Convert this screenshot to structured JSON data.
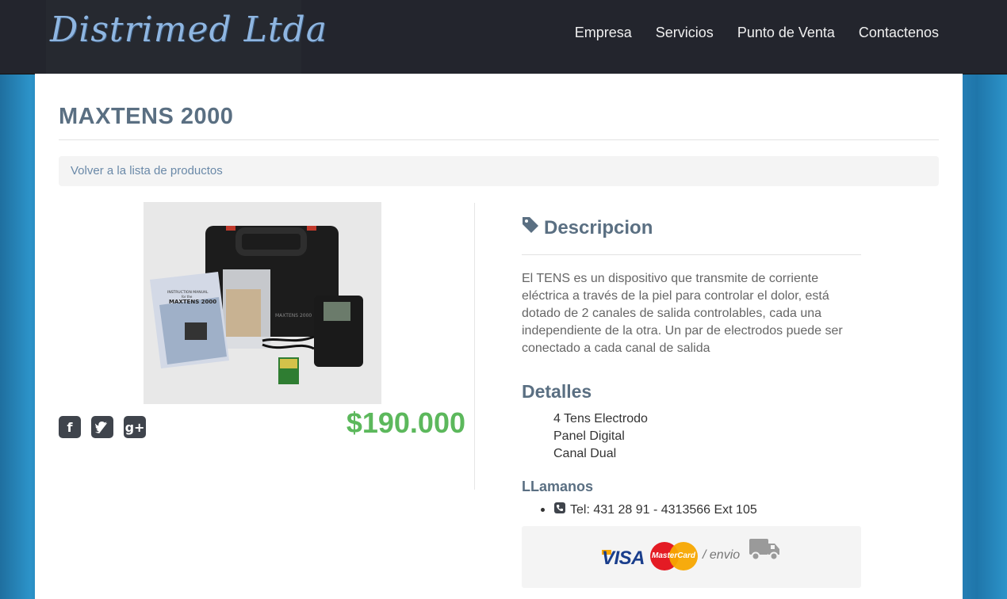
{
  "header": {
    "logo": "Distrimed Ltda",
    "nav": [
      "Empresa",
      "Servicios",
      "Punto de Venta",
      "Contactenos"
    ]
  },
  "product": {
    "title": "MAXTENS 2000",
    "back_link": "Volver a la lista de productos",
    "price": "$190.000",
    "image_labels": {
      "manual_line1": "INSTRUCTION MANUAL",
      "manual_line2": "for the",
      "manual_line3": "MAXTENS 2000",
      "case_label": "MAXTENS 2000"
    }
  },
  "social": {
    "icons": [
      "facebook-icon",
      "twitter-icon",
      "google-plus-icon"
    ]
  },
  "description": {
    "heading": "Descripcion",
    "text": "El TENS es un dispositivo que transmite de corriente eléctrica a través de la piel para controlar el dolor, está dotado de 2 canales de salida controlables, cada una independiente de la otra. Un par de electrodos puede ser conectado a cada canal de salida"
  },
  "details": {
    "heading": "Detalles",
    "items": [
      "4 Tens Electrodo",
      "Panel Digital",
      "Canal Dual"
    ]
  },
  "contact": {
    "heading": "LLamanos",
    "phone": "Tel: 431 28 91 - 4313566 Ext 105"
  },
  "payment": {
    "visa": "VISA",
    "mastercard": "MasterCard",
    "envio": "/ envio"
  },
  "colors": {
    "header_bg": "#23252d",
    "logo": "#8fb6e1",
    "heading": "#5a6f82",
    "price": "#5cb85c",
    "link": "#6a89a8"
  }
}
